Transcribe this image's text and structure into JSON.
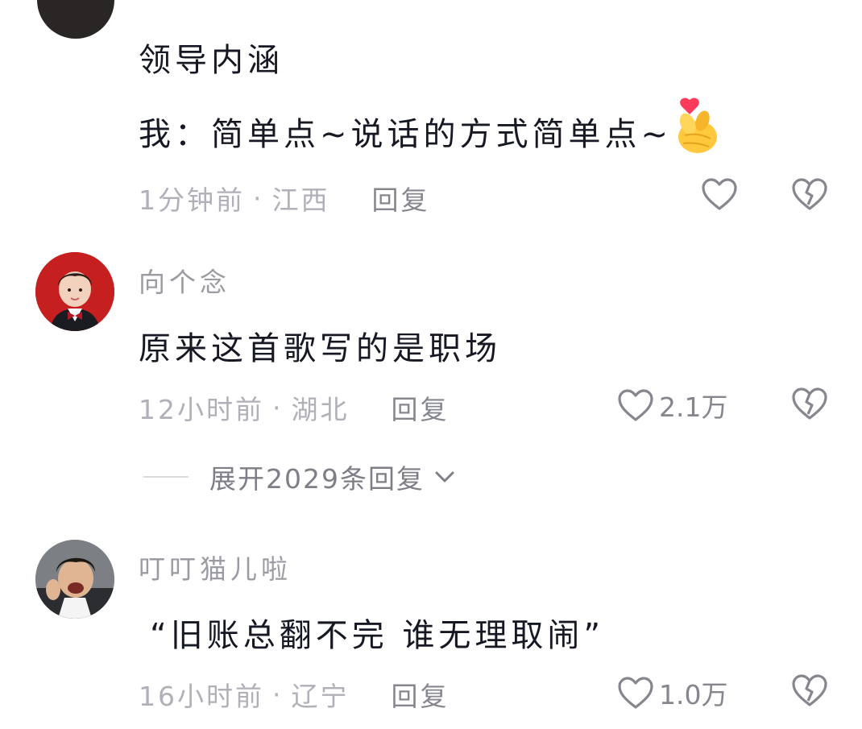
{
  "colors": {
    "text": "#161823",
    "secondary": "#86878e",
    "meta": "#b0b1b8",
    "heart_emoji": "#ff3b5c"
  },
  "comments": [
    {
      "text_lines": [
        "领导内涵",
        "我：简单点~说话的方式简单点~"
      ],
      "emoji_icon": "finger-heart-emoji-icon",
      "time": "1分钟前",
      "location": "江西",
      "reply_label": "回复",
      "like_count": ""
    },
    {
      "username": "向个念",
      "text": "原来这首歌写的是职场",
      "time": "12小时前",
      "location": "湖北",
      "reply_label": "回复",
      "like_count": "2.1万",
      "expand_label": "展开2029条回复"
    },
    {
      "username": "叮叮猫儿啦",
      "text": "“旧账总翻不完 谁无理取闹”",
      "time": "16小时前",
      "location": "辽宁",
      "reply_label": "回复",
      "like_count": "1.0万"
    }
  ],
  "separator": "·"
}
